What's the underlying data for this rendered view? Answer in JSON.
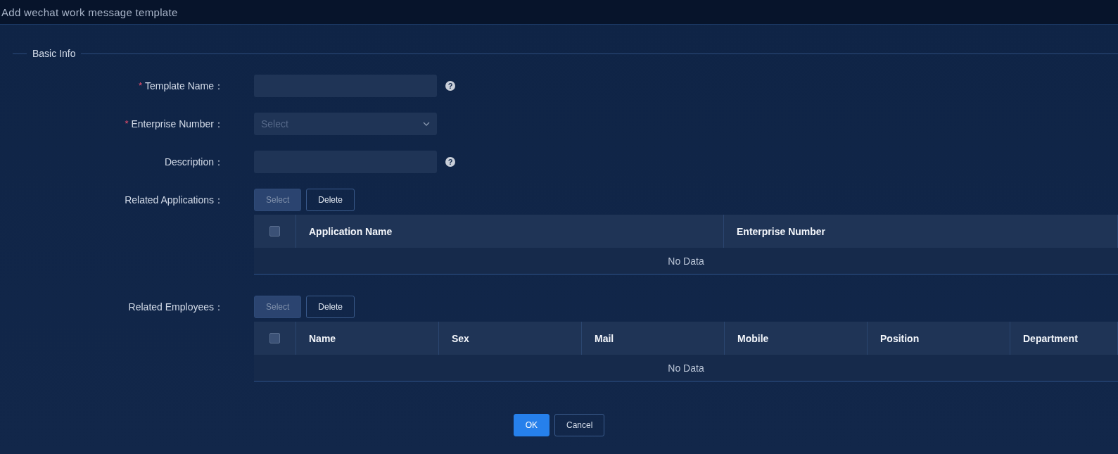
{
  "window": {
    "title": "Add wechat work message template"
  },
  "section": {
    "title": "Basic Info"
  },
  "fields": [
    {
      "kind": "input",
      "label": "Template Name：",
      "required_mark": "*",
      "help": "?"
    },
    {
      "kind": "select",
      "label": "Enterprise Number：",
      "required_mark": "*",
      "placeholder": "Select"
    },
    {
      "kind": "input",
      "label": "Description：",
      "help": "?"
    }
  ],
  "tables": [
    {
      "label": "Related Applications：",
      "buttons": [
        {
          "label": "Select",
          "disabled": true
        },
        {
          "label": "Delete",
          "disabled": false
        }
      ],
      "select_all": {
        "checked": false
      },
      "columns": [
        "Application Name",
        "Enterprise Number"
      ],
      "empty_text": "No Data"
    },
    {
      "label": "Related Employees：",
      "buttons": [
        {
          "label": "Select",
          "disabled": true
        },
        {
          "label": "Delete",
          "disabled": false
        }
      ],
      "select_all": {
        "checked": false
      },
      "columns": [
        "Name",
        "Sex",
        "Mail",
        "Mobile",
        "Position",
        "Department"
      ],
      "empty_text": "No Data"
    }
  ],
  "footer": {
    "buttons": [
      {
        "label": "OK",
        "primary": true
      },
      {
        "label": "Cancel",
        "primary": false
      }
    ]
  }
}
